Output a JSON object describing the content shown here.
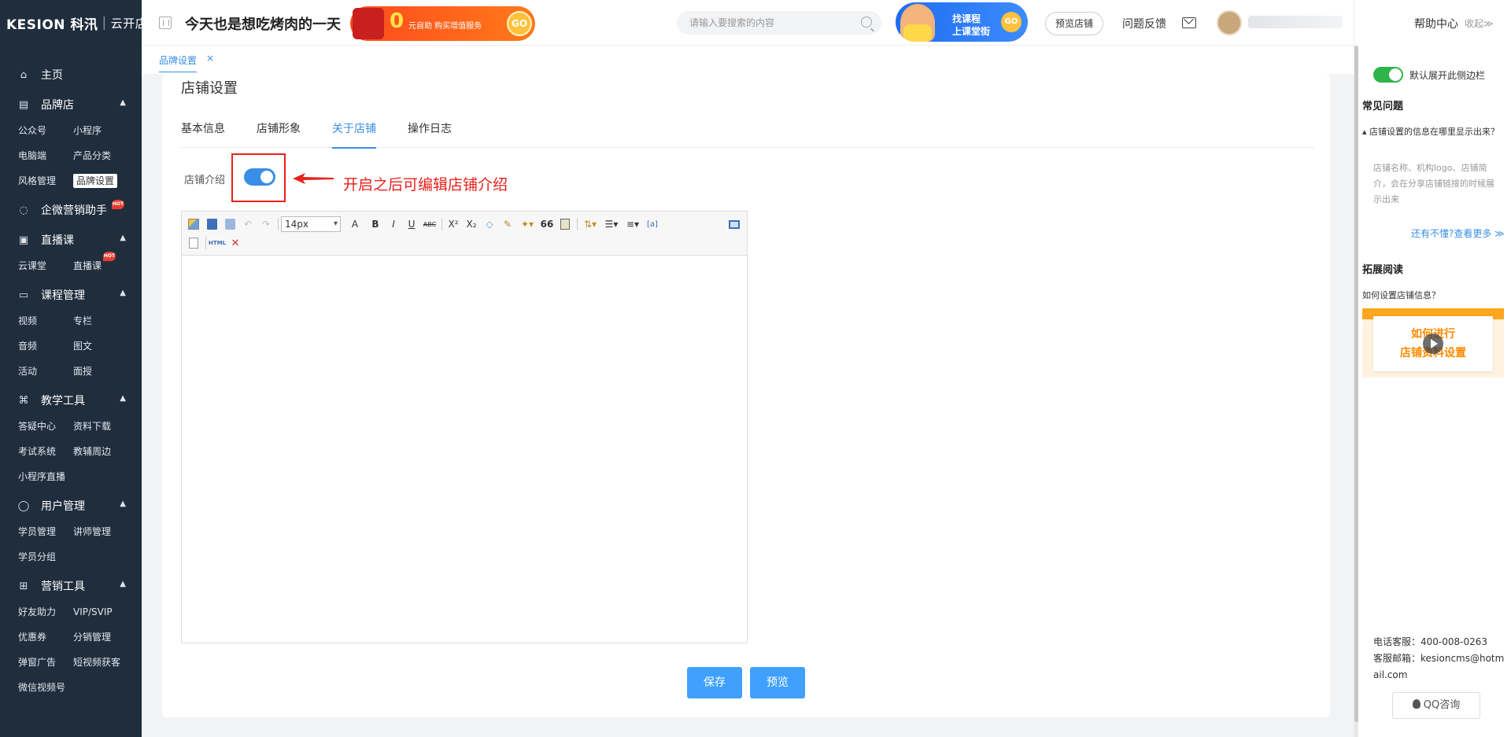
{
  "brand": {
    "name": "KESION 科汛",
    "sub": "云开店"
  },
  "header": {
    "slogan": "今天也是想吃烤肉的一天",
    "promo": {
      "zero": "0",
      "text": "元自助 购买增值服务",
      "go": "GO"
    },
    "search_placeholder": "请输入要搜索的内容",
    "course_banner": {
      "line1": "找课程",
      "line2": "上课堂街",
      "go": "GO"
    },
    "preview_store": "预览店铺",
    "feedback": "问题反馈",
    "help_center": "帮助中心",
    "collapse": "收起≫"
  },
  "sidebar": {
    "home": "主页",
    "groups": [
      {
        "title": "品牌店",
        "items": [
          "公众号",
          "小程序",
          "电脑端",
          "产品分类",
          "风格管理",
          "品牌设置"
        ],
        "active": "品牌设置"
      },
      {
        "title": "企微营销助手",
        "hot": "HOT",
        "items": []
      },
      {
        "title": "直播课",
        "items": [
          "云课堂",
          "直播课"
        ],
        "hot_item": "HOT"
      },
      {
        "title": "课程管理",
        "items": [
          "视频",
          "专栏",
          "音频",
          "图文",
          "活动",
          "面授"
        ]
      },
      {
        "title": "教学工具",
        "items": [
          "答疑中心",
          "资料下载",
          "考试系统",
          "教辅周边",
          "小程序直播"
        ]
      },
      {
        "title": "用户管理",
        "items": [
          "学员管理",
          "讲师管理",
          "学员分组"
        ]
      },
      {
        "title": "营销工具",
        "items": [
          "好友助力",
          "VIP/SVIP",
          "优惠券",
          "分销管理",
          "弹窗广告",
          "短视频获客",
          "微信视频号"
        ]
      }
    ]
  },
  "tabs_bar": {
    "current": "品牌设置",
    "close": "×"
  },
  "main": {
    "title": "店铺设置",
    "tabs": [
      "基本信息",
      "店铺形象",
      "关于店铺",
      "操作日志"
    ],
    "active_tab": "关于店铺",
    "field_label": "店铺介绍",
    "toggle_on": true,
    "annotation": "开启之后可编辑店铺介绍",
    "editor": {
      "font_size": "14px",
      "tools": {
        "font_color": "A",
        "bold": "B",
        "italic": "I",
        "underline": "U",
        "strike": "ABC",
        "sup": "X²",
        "sub": "X₂",
        "quote": "66",
        "html": "HTML"
      }
    },
    "save_button": "保存",
    "preview_button": "预览"
  },
  "right_panel": {
    "toggle_label": "默认展开此侧边栏",
    "faq_title": "常见问题",
    "faq_question": "店铺设置的信息在哪里显示出来？",
    "faq_answer": "店铺名称、机构logo、店铺简介，会在分享店铺链接的时候展示出来",
    "more_link": "还有不懂?查看更多 ≫",
    "reading_title": "拓展阅读",
    "reading_question": "如何设置店铺信息？",
    "video_line1": "如何进行",
    "video_line2": "店铺资料设置",
    "phone": "电话客服：400-008-0263",
    "email": "客服邮箱：kesioncms@hotmail.com",
    "qq_button": "QQ咨询"
  },
  "colors": {
    "sidebar_bg": "#1f2d3d",
    "accent": "#3a8ee6",
    "primary_button": "#40a0ff",
    "annotation_red": "#e8211b",
    "toggle_green": "#2fb44a"
  }
}
